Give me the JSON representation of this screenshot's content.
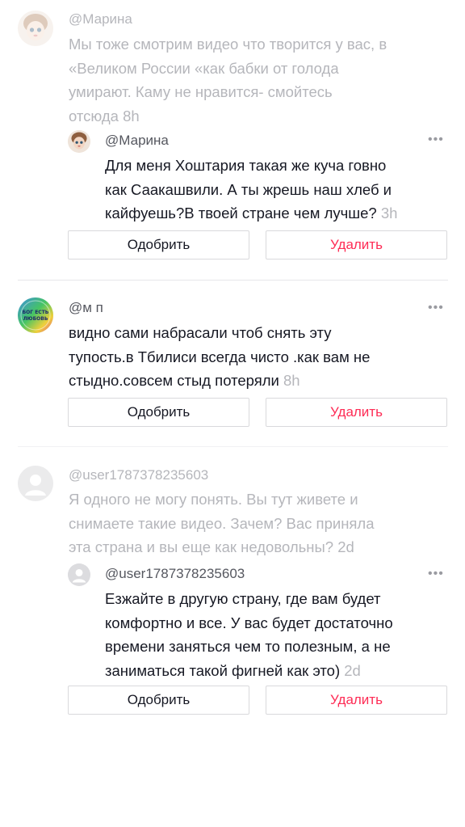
{
  "threads": [
    {
      "comment": {
        "username": "@Марина",
        "lines": [
          "Мы тоже смотрим видео что творится у вас, в",
          "«Великом России «как бабки от голода",
          "умирают. Каму не нравится- смойтесь"
        ],
        "last_line": "отсюда",
        "time": "8h"
      },
      "reply": {
        "username": "@Марина",
        "lines": [
          "Для меня Хоштария такая же куча говно",
          "как Саакашвили. А ты жрешь наш хлеб и"
        ],
        "last_line": "кайфуешь?В твоей стране чем лучше?",
        "time": "3h"
      },
      "approve_label": "Одобрить",
      "delete_label": "Удалить"
    },
    {
      "comment": {
        "username": "@м п",
        "avatar_text": [
          "БОГ ЕСТЬ",
          "ЛЮБОВЬ"
        ],
        "lines": [
          "видно сами набрасали чтоб снять эту",
          "тупость.в Тбилиси всегда чисто .как вам не"
        ],
        "last_line": "стыдно.совсем стыд потеряли",
        "time": "8h"
      },
      "approve_label": "Одобрить",
      "delete_label": "Удалить"
    },
    {
      "comment": {
        "username": "@user1787378235603",
        "lines": [
          "Я одного не могу понять. Вы тут живете и",
          "снимаете такие видео. Зачем? Вас приняла"
        ],
        "last_line": "эта страна и вы еще как недовольны?",
        "time": "2d"
      },
      "reply": {
        "username": "@user1787378235603",
        "lines": [
          "Езжайте в другую страну, где вам будет",
          "комфортно и все. У вас будет достаточно",
          "времени заняться чем то полезным, а не"
        ],
        "last_line": "заниматься такой фигней как это)",
        "time": "2d"
      },
      "approve_label": "Одобрить",
      "delete_label": "Удалить"
    }
  ],
  "more_icon": "ellipsis-icon",
  "accent_color": "#fe2c55"
}
